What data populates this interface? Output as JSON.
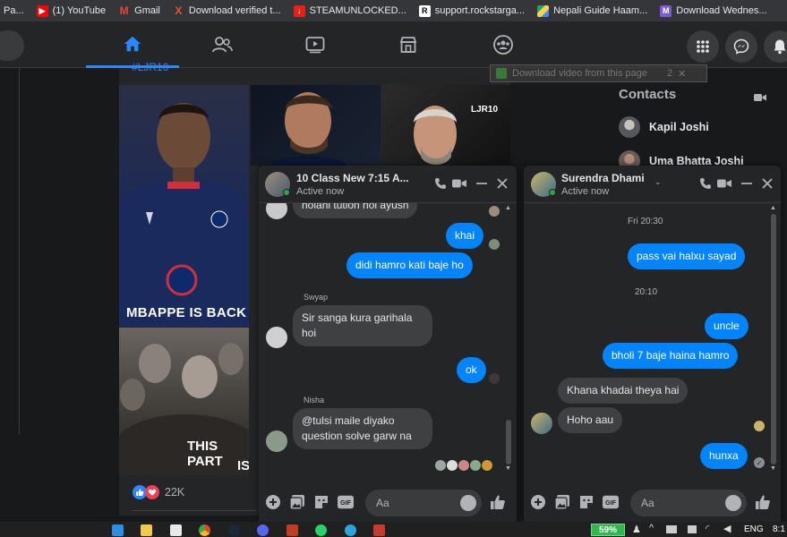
{
  "bookmarks": [
    {
      "label": "Pa...",
      "icon": "page-icon",
      "color": "#5f6368"
    },
    {
      "label": "(1) YouTube",
      "icon": "youtube-icon",
      "color": "#ff0000"
    },
    {
      "label": "Gmail",
      "icon": "gmail-icon",
      "color": "#ea4335"
    },
    {
      "label": "Download verified t...",
      "icon": "x-icon",
      "color": "#e8552d"
    },
    {
      "label": "STEAMUNLOCKED...",
      "icon": "steamunlocked-icon",
      "color": "#e62117"
    },
    {
      "label": "support.rockstarga...",
      "icon": "rockstar-icon",
      "color": "#ffffff"
    },
    {
      "label": "Nepali Guide Haam...",
      "icon": "drive-icon",
      "color": "#1fa463"
    },
    {
      "label": "Download Wednes...",
      "icon": "m-icon",
      "color": "#7b5cd6"
    }
  ],
  "post": {
    "hashtag": "#LJR10",
    "image_caption_1": "MBAPPE IS BACK",
    "image_caption_2": "THIS PART",
    "image_caption_3": "IS",
    "watermark": "LJR10",
    "reaction_count": "22K"
  },
  "download_bar": {
    "label": "Download video from this page",
    "badge": "2"
  },
  "contacts": {
    "title": "Contacts",
    "items": [
      {
        "name": "Kapil Joshi"
      },
      {
        "name": "Uma Bhatta Joshi"
      }
    ]
  },
  "chat1": {
    "name": "10 Class New 7:15 A...",
    "status": "Active now",
    "cut_message": "holahi tution hol ayush",
    "messages": [
      {
        "text": "khai"
      },
      {
        "text": "didi hamro kati baje ho"
      },
      {
        "sender": "Swyap",
        "text": "Sir sanga kura garihala hoi"
      },
      {
        "text": "ok"
      },
      {
        "sender": "Nisha",
        "text": "@tulsi maile diyako question solve garw na"
      }
    ],
    "placeholder": "Aa"
  },
  "chat2": {
    "name": "Surendra Dhami",
    "status": "Active now",
    "messages": [
      {
        "time": "Fri 20:30"
      },
      {
        "text": "pass vai halxu sayad"
      },
      {
        "time": "20:10"
      },
      {
        "text": "uncle"
      },
      {
        "text": "bholi 7 baje haina hamro"
      },
      {
        "text": "Khana khadai theya hai"
      },
      {
        "text": "Hoho aau"
      },
      {
        "text": "hunxa"
      }
    ],
    "placeholder": "Aa"
  },
  "taskbar": {
    "battery": "59%",
    "language": "ENG",
    "time": "8:1"
  },
  "colors": {
    "accent": "#0084ff",
    "nav_active": "#2d88ff",
    "online": "#31a24c",
    "background": "#18191a",
    "surface": "#242526"
  }
}
